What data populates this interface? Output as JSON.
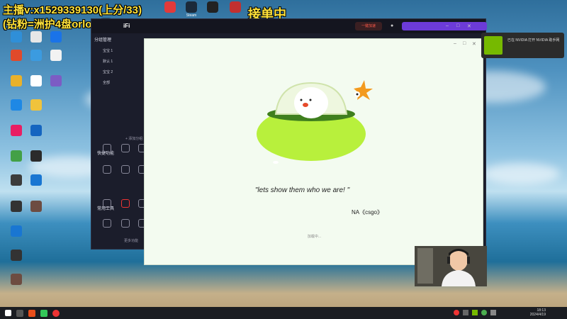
{
  "overlay": {
    "line1": "主播v:x1529339130(上分/33)",
    "line2": "(钻粉=洲护4盘orlol4局)",
    "status": "接单中"
  },
  "top_icons": [
    {
      "label": "",
      "color": "#e23a3a"
    },
    {
      "label": "Steam",
      "color": "#1b2a3a"
    },
    {
      "label": "",
      "color": "#222"
    },
    {
      "label": "",
      "color": "#c23030"
    }
  ],
  "desktop_icons": [
    {
      "label": "",
      "color": "#2f8fd8"
    },
    {
      "label": "",
      "color": "#e7e7e7"
    },
    {
      "label": "",
      "color": "#1a73e8"
    },
    {
      "label": "",
      "color": "#e04a2b"
    },
    {
      "label": "",
      "color": "#3b9be0"
    },
    {
      "label": "",
      "color": "#f2f2f2"
    },
    {
      "label": "",
      "color": "#e9b12b"
    },
    {
      "label": "",
      "color": "#ffffff"
    },
    {
      "label": "",
      "color": "#7c5cc4"
    },
    {
      "label": "",
      "color": "#1e88e5"
    },
    {
      "label": "",
      "color": "#f0c33c"
    },
    {
      "label": "",
      "color": "#e91e63"
    },
    {
      "label": "",
      "color": "#1565c0"
    },
    {
      "label": "",
      "color": "#43a047"
    },
    {
      "label": "",
      "color": "#2b2b2b"
    },
    {
      "label": "",
      "color": "#3c3c3c"
    },
    {
      "label": "",
      "color": "#1976d2"
    },
    {
      "label": "",
      "color": "#333"
    },
    {
      "label": "",
      "color": "#6d4c41"
    }
  ],
  "dark_app": {
    "logo": "iFi",
    "version": "",
    "speed_btn": "一键加速",
    "sidebar_header": "分组管理",
    "tabs": [
      "",
      ""
    ],
    "items": [
      "宝宝 1",
      "默认 1",
      "宝宝 2",
      "全部"
    ],
    "add_label": "+ 添加分组",
    "section1": "快捷功能",
    "section2": "常用工具",
    "more": "更多功能"
  },
  "splash": {
    "quote": "\"lets show them who we are! \"",
    "author": "NA《csgo》",
    "loading": "加载中..."
  },
  "notification": {
    "text": "已在 NVIDIA 打开 NVIDIA 助手网"
  },
  "clock": {
    "time": "18:13",
    "date": "2024/4/19"
  },
  "colors": {
    "ufo_green": "#b8f03c",
    "ufo_dark": "#3f7f1e",
    "star": "#f39a1e"
  }
}
